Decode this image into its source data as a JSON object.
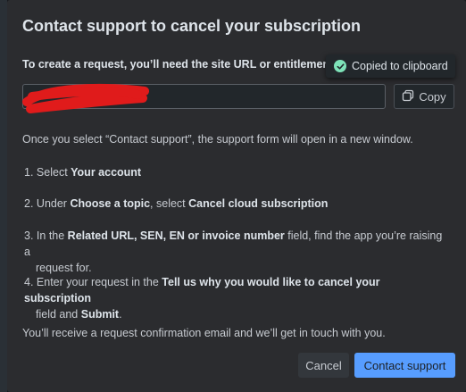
{
  "dialog": {
    "title": "Contact support to cancel your subscription",
    "field_label": "To create a request, you’ll need the site URL or entitlement",
    "url_value": "",
    "copy_label": "Copy",
    "toast_text": "Copied to clipboard",
    "intro": "Once you select “Contact support”, the support form will open in a new window.",
    "steps": [
      {
        "n": "1.",
        "a": "Select ",
        "b": "Your account",
        "c": ""
      },
      {
        "n": "2.",
        "a": "Under ",
        "b": "Choose a topic",
        "c": ", select ",
        "d": "Cancel cloud subscription"
      },
      {
        "n": "3.",
        "a": "In the ",
        "b": "Related URL, SEN, EN or invoice number",
        "c": " field, find the app you’re raising a",
        "cont": "request for."
      },
      {
        "n": "4.",
        "a": "Enter your request in the ",
        "b": "Tell us why you would like to cancel your subscription",
        "cont_a": "field and ",
        "cont_b": "Submit",
        "cont_c": "."
      }
    ],
    "outro": "You’ll receive a request confirmation email and we’ll get in touch with you.",
    "cancel_label": "Cancel",
    "primary_label": "Contact support"
  },
  "colors": {
    "dialog_bg": "#2b2c2f",
    "primary": "#579dff",
    "success": "#7ee2b8",
    "redaction": "#e01b1b"
  },
  "icons": {
    "toast": "check-circle-icon",
    "copy": "copy-icon"
  }
}
